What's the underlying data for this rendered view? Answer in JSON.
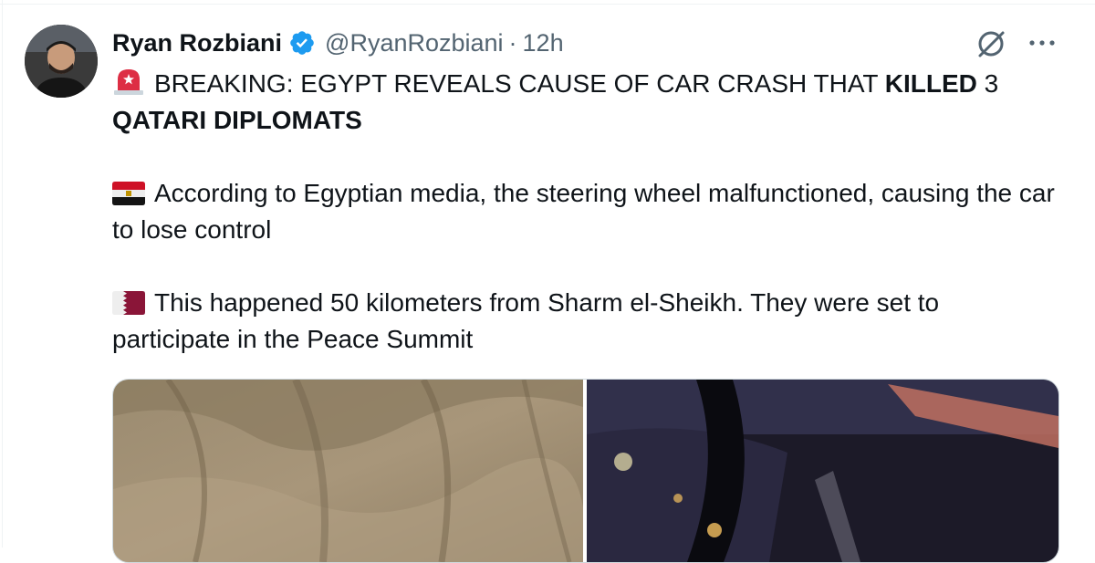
{
  "author": {
    "name": "Ryan Rozbiani",
    "handle": "@RyanRozbiani",
    "separator": "·",
    "time": "12h",
    "verified": true
  },
  "icons": [
    "grok-icon",
    "more-options-icon",
    "verified-badge-icon",
    "rotating-light-icon",
    "egypt-flag-icon",
    "qatar-flag-icon"
  ],
  "tweet": {
    "line1_text": "BREAKING: EGYPT REVEALS CAUSE OF CAR CRASH THAT ",
    "line1_bold": "KILLED",
    "line1_end": " 3",
    "line2_bold": "QATARI DIPLOMATS",
    "para2": "According to Egyptian media, the steering wheel malfunctioned, causing the car to lose control",
    "para3": "This happened 50 kilometers from Sharm el-Sheikh. They were set to participate in the Peace Summit"
  },
  "media": {
    "count": 2
  },
  "colors": {
    "text": "#0f1419",
    "secondary": "#536471",
    "verified_blue": "#1d9bf0",
    "border": "#cfd9de"
  }
}
